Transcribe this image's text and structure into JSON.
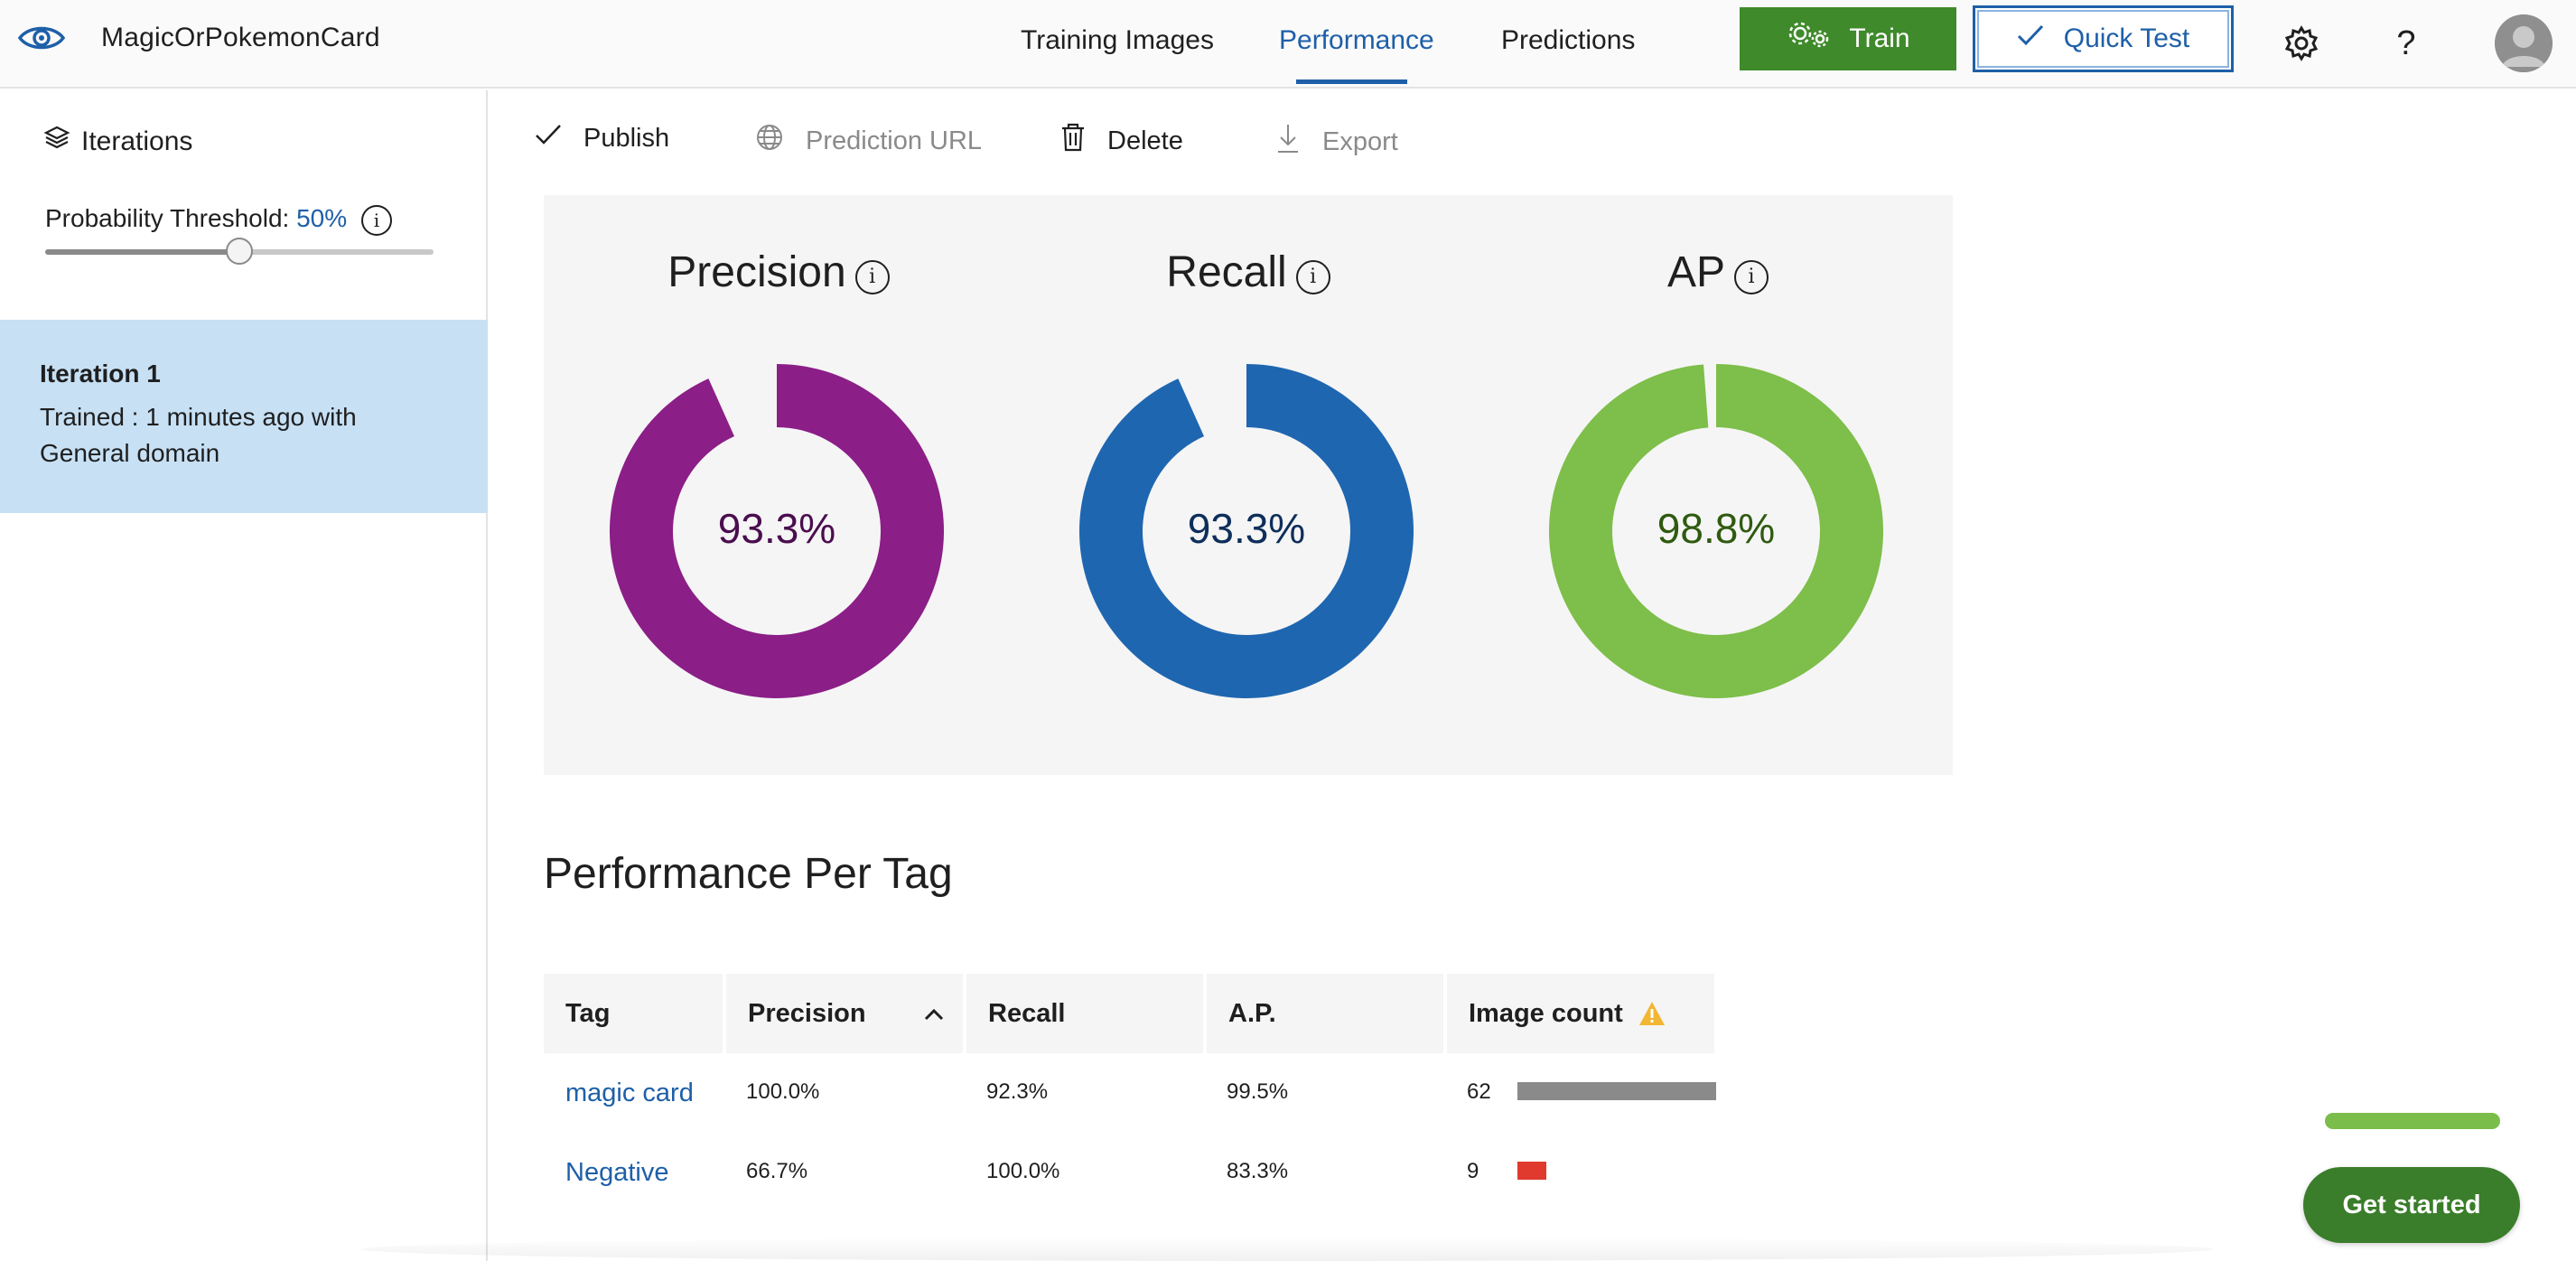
{
  "app": {
    "title": "MagicOrPokemonCard"
  },
  "nav": {
    "tabs": [
      {
        "label": "Training Images",
        "active": false
      },
      {
        "label": "Performance",
        "active": true
      },
      {
        "label": "Predictions",
        "active": false
      }
    ],
    "train_label": "Train",
    "quick_test_label": "Quick Test"
  },
  "sidebar": {
    "iterations_label": "Iterations",
    "threshold_label": "Probability Threshold:",
    "threshold_value": "50%",
    "threshold_fraction": 0.5,
    "iteration": {
      "title": "Iteration 1",
      "description": "Trained : 1 minutes ago with General domain"
    }
  },
  "toolbar": {
    "publish": "Publish",
    "prediction_url": "Prediction URL",
    "delete": "Delete",
    "export": "Export"
  },
  "metrics": [
    {
      "name": "Precision",
      "value": "93.3%",
      "fraction": 0.933,
      "color": "#8b1e87",
      "text_color": "#4a0e4e"
    },
    {
      "name": "Recall",
      "value": "93.3%",
      "fraction": 0.933,
      "color": "#1f66b0",
      "text_color": "#0e2f5a"
    },
    {
      "name": "AP",
      "value": "98.8%",
      "fraction": 0.988,
      "color": "#7ebe4a",
      "text_color": "#2f5a10"
    }
  ],
  "per_tag": {
    "title": "Performance Per Tag",
    "columns": [
      "Tag",
      "Precision",
      "Recall",
      "A.P.",
      "Image count"
    ],
    "rows": [
      {
        "tag": "magic card",
        "precision": "100.0%",
        "recall": "92.3%",
        "ap": "99.5%",
        "count": "62",
        "count_value": 62,
        "bar_color": "#8a8a8a"
      },
      {
        "tag": "Negative",
        "precision": "66.7%",
        "recall": "100.0%",
        "ap": "83.3%",
        "count": "9",
        "count_value": 9,
        "bar_color": "#e03a2e"
      }
    ]
  },
  "get_started": "Get started",
  "colors": {
    "accent": "#1e5fa8",
    "train_button": "#3f8a2b",
    "selected_iteration": "#c7e0f4",
    "warning": "#f2b632"
  }
}
